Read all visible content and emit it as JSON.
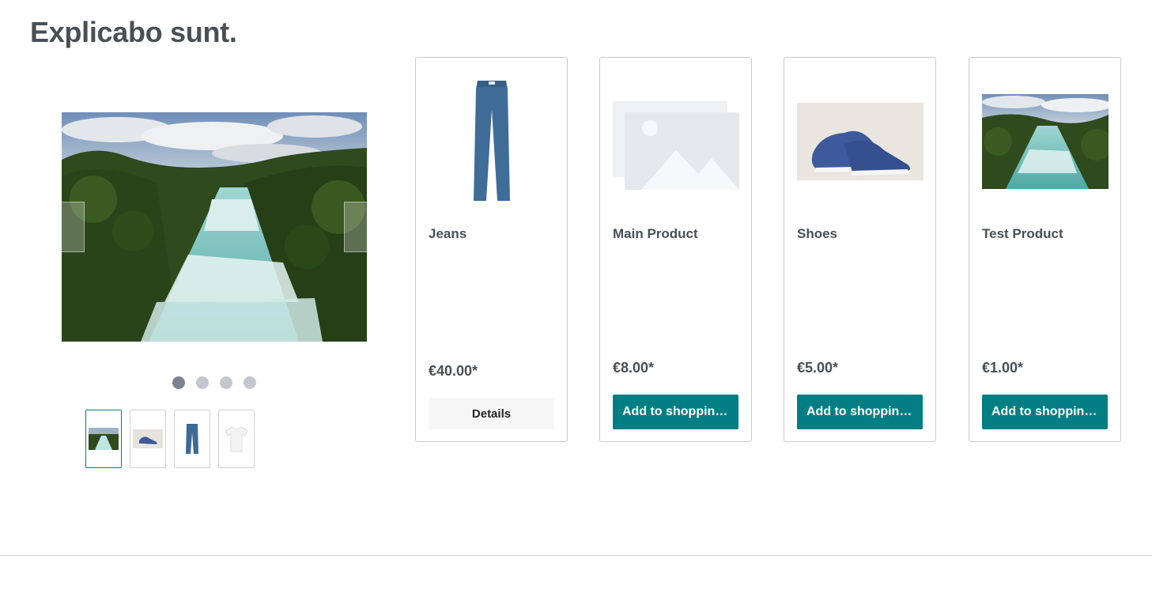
{
  "page": {
    "title": "Explicabo sunt."
  },
  "carousel": {
    "slides": [
      {
        "name": "river"
      },
      {
        "name": "shoes"
      },
      {
        "name": "jeans"
      },
      {
        "name": "t-shirt"
      }
    ],
    "active_index": 0,
    "prev_icon": "chevron-left-icon",
    "next_icon": "chevron-right-icon"
  },
  "products": [
    {
      "name": "Jeans",
      "price": "€40.00*",
      "action": "Details",
      "image": "jeans"
    },
    {
      "name": "Main Product",
      "price": "€8.00*",
      "action": "Add to shopping cart",
      "image": "placeholder"
    },
    {
      "name": "Shoes",
      "price": "€5.00*",
      "action": "Add to shopping cart",
      "image": "shoes"
    },
    {
      "name": "Test Product",
      "price": "€1.00*",
      "action": "Add to shopping cart",
      "image": "river"
    }
  ],
  "colors": {
    "accent": "#017e84",
    "text": "#4a4f55",
    "border": "#c8cbcf"
  }
}
